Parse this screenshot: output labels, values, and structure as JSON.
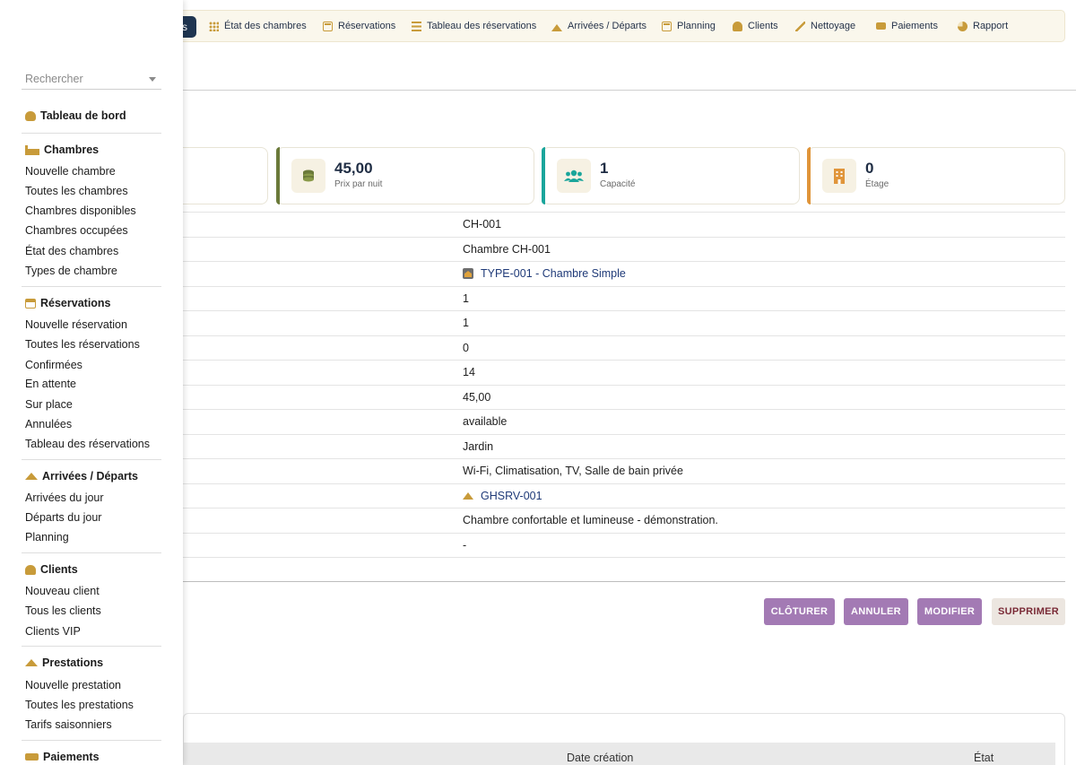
{
  "topnav": {
    "active_label": "s",
    "items": [
      {
        "label": "État des chambres",
        "icon": "grid-icon"
      },
      {
        "label": "Réservations",
        "icon": "calendar-check-icon"
      },
      {
        "label": "Tableau des réservations",
        "icon": "list-icon"
      },
      {
        "label": "Arrivées / Départs",
        "icon": "bell-icon"
      },
      {
        "label": "Planning",
        "icon": "calendar-icon"
      },
      {
        "label": "Clients",
        "icon": "user-icon"
      },
      {
        "label": "Nettoyage",
        "icon": "broom-icon"
      },
      {
        "label": "Paiements",
        "icon": "money-icon"
      },
      {
        "label": "Rapport",
        "icon": "pie-chart-icon"
      }
    ]
  },
  "cards": [
    {
      "value": "45,00",
      "label": "Prix par nuit",
      "icon": "coins-icon",
      "accent": "#6b7a3a"
    },
    {
      "value": "1",
      "label": "Capacité",
      "icon": "users-icon",
      "accent": "#1aa59b"
    },
    {
      "value": "0",
      "label": "Étage",
      "icon": "building-icon",
      "accent": "#e0953a"
    }
  ],
  "details": {
    "code": "CH-001",
    "name": "Chambre CH-001",
    "type": "TYPE-001 - Chambre Simple",
    "r4": "1",
    "r5": "1",
    "r6": "0",
    "r7": "14",
    "price": "45,00",
    "status": "available",
    "view": "Jardin",
    "amenities": "Wi-Fi, Climatisation, TV, Salle de bain privée",
    "service": "GHSRV-001",
    "description": "Chambre confortable et lumineuse - démonstration.",
    "empty": "-"
  },
  "actions": {
    "close": "CLÔTURER",
    "cancel": "ANNULER",
    "edit": "MODIFIER",
    "delete": "SUPPRIMER"
  },
  "table": {
    "col_date": "Date création",
    "col_state": "État"
  },
  "sidebar": {
    "search_placeholder": "Rechercher",
    "dashboard": "Tableau de bord",
    "chambres": {
      "title": "Chambres",
      "items": [
        "Nouvelle chambre",
        "Toutes les chambres",
        "Chambres disponibles",
        "Chambres occupées",
        "État des chambres",
        "Types de chambre"
      ]
    },
    "reservations": {
      "title": "Réservations",
      "items": [
        "Nouvelle réservation",
        "Toutes les réservations",
        "Confirmées",
        "En attente",
        "Sur place",
        "Annulées",
        "Tableau des réservations"
      ]
    },
    "arrivees": {
      "title": "Arrivées / Départs",
      "items": [
        "Arrivées du jour",
        "Départs du jour",
        "Planning"
      ]
    },
    "clients": {
      "title": "Clients",
      "items": [
        "Nouveau client",
        "Tous les clients",
        "Clients VIP"
      ]
    },
    "prestations": {
      "title": "Prestations",
      "items": [
        "Nouvelle prestation",
        "Toutes les prestations",
        "Tarifs saisonniers"
      ]
    },
    "paiements": {
      "title": "Paiements"
    }
  }
}
